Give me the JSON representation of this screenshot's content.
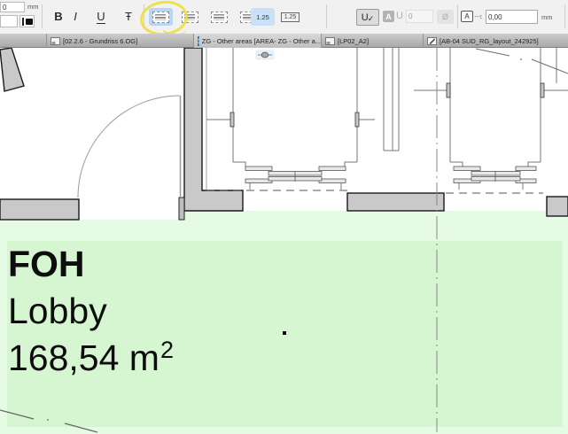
{
  "toolbar": {
    "font_size_value": "0",
    "font_size_unit": "mm",
    "bold_label": "B",
    "italic_label": "I",
    "underline_label": "U",
    "strike_label": "Ŧ",
    "line_spacing_button": "1.25",
    "line_spacing_box": "1.25",
    "spell_u": "U",
    "spell_check": "✓",
    "char_chip_a": "A",
    "char_gray_u": "U",
    "disabled_count_value": "0",
    "diameter_label": "Ø",
    "offset_icon_label": "A",
    "offset_icon_marks": "⋯↕",
    "offset_value": "0,00",
    "offset_unit": "mm"
  },
  "tabs": [
    {
      "label": "[02.2.6 - Grundriss 6.OG]"
    },
    {
      "label": "ZG - Other areas [AREA- ZG - Other a..."
    },
    {
      "label": "[LP02_A2]"
    },
    {
      "label": "[AB-04 SUD_RG_layout_242925]"
    }
  ],
  "zone": {
    "name": "FOH",
    "subname": "Lobby",
    "area": "168,54 m",
    "area_superscript": "2"
  },
  "colors": {
    "zone_fill_light": "#e6fbe4",
    "zone_fill_selected": "#d6f6d2",
    "wall_fill": "#c9c9c9",
    "accent_blue": "#c9e0f7",
    "annotation_yellow": "#efe03c"
  }
}
